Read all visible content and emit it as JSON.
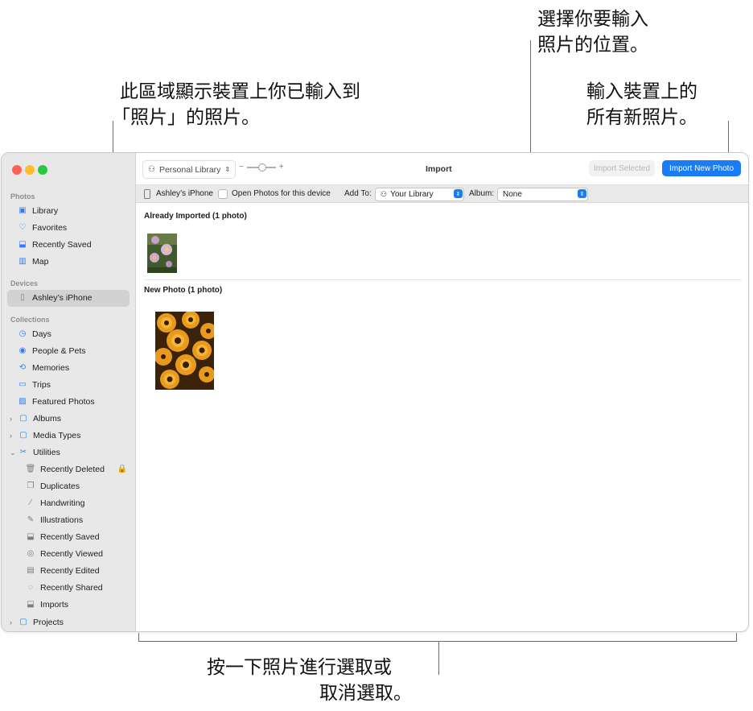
{
  "callouts": {
    "imported_area": [
      "此區域顯示裝置上你已輸入到",
      "「照片」的照片。"
    ],
    "location": [
      "選擇你要輸入",
      "照片的位置。"
    ],
    "import_new": [
      "輸入裝置上的",
      "所有新照片。"
    ],
    "click_select": [
      "按一下照片進行選取或",
      "取消選取。"
    ]
  },
  "sidebar": {
    "sections": {
      "photos": "Photos",
      "devices": "Devices",
      "collections": "Collections"
    },
    "photos_items": [
      {
        "label": "Library",
        "icon": "library-icon"
      },
      {
        "label": "Favorites",
        "icon": "heart-icon"
      },
      {
        "label": "Recently Saved",
        "icon": "recently-saved-icon"
      },
      {
        "label": "Map",
        "icon": "map-icon"
      }
    ],
    "device_item": {
      "label": "Ashley’s iPhone",
      "icon": "iphone-icon"
    },
    "collection_items": [
      {
        "label": "Days",
        "icon": "clock-icon"
      },
      {
        "label": "People & Pets",
        "icon": "person-circle-icon"
      },
      {
        "label": "Memories",
        "icon": "memories-icon"
      },
      {
        "label": "Trips",
        "icon": "suitcase-icon"
      },
      {
        "label": "Featured Photos",
        "icon": "featured-photos-icon"
      },
      {
        "label": "Albums",
        "icon": "folder-icon"
      },
      {
        "label": "Media Types",
        "icon": "folder-icon"
      },
      {
        "label": "Utilities",
        "icon": "tools-icon"
      }
    ],
    "utility_items": [
      {
        "label": "Recently Deleted",
        "icon": "trash-icon"
      },
      {
        "label": "Duplicates",
        "icon": "duplicates-icon"
      },
      {
        "label": "Handwriting",
        "icon": "pencil-icon"
      },
      {
        "label": "Illustrations",
        "icon": "illustrations-icon"
      },
      {
        "label": "Recently Saved",
        "icon": "recently-saved-icon"
      },
      {
        "label": "Recently Viewed",
        "icon": "eye-icon"
      },
      {
        "label": "Recently Edited",
        "icon": "edit-icon"
      },
      {
        "label": "Recently Shared",
        "icon": "shared-icon"
      },
      {
        "label": "Imports",
        "icon": "import-icon"
      }
    ],
    "projects": {
      "label": "Projects",
      "icon": "folder-icon"
    }
  },
  "toolbar": {
    "library_selector": "Personal Library",
    "zoom_minus": "−",
    "zoom_plus": "+",
    "zoom_level": 0.55,
    "title": "Import",
    "import_selected": "Import Selected",
    "import_new": "Import New Photo"
  },
  "device_bar": {
    "device_name": "Ashley’s iPhone",
    "open_photos": "Open Photos for this device",
    "add_to_label": "Add To:",
    "add_to_value": "Your Library",
    "album_label": "Album:",
    "album_value": "None"
  },
  "content": {
    "already_imported": "Already Imported (1 photo)",
    "new_photo": "New Photo (1 photo)"
  },
  "colors": {
    "accent": "#1a7cf5",
    "sidebar_bg": "#e8e8e8",
    "traffic_red": "#fe5f57",
    "traffic_yellow": "#febc2e",
    "traffic_green": "#28c840"
  }
}
